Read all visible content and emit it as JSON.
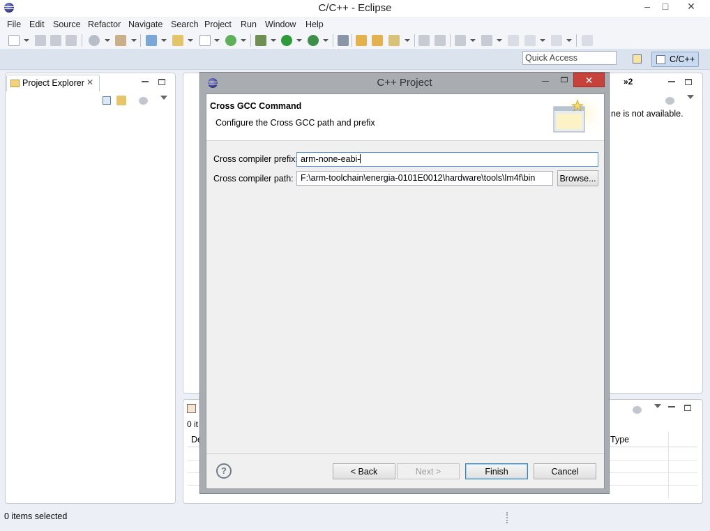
{
  "window": {
    "title": "C/C++ - Eclipse",
    "minimize": "–",
    "maximize": "□",
    "close": "✕"
  },
  "menu": [
    "File",
    "Edit",
    "Source",
    "Refactor",
    "Navigate",
    "Search",
    "Project",
    "Run",
    "Window",
    "Help"
  ],
  "quick_access": {
    "placeholder": "Quick Access"
  },
  "perspective": {
    "label": "C/C++"
  },
  "project_explorer": {
    "tab_label": "Project Explorer",
    "close": "✕"
  },
  "editor": {
    "overflow_tabs": "»2",
    "message_fragment": "ne is not available."
  },
  "bottom_panel": {
    "items_count_fragment": "0 it",
    "col_desc_fragment": "De",
    "col_type": "Type"
  },
  "status": {
    "text": "0 items selected"
  },
  "dialog": {
    "title": "C++ Project",
    "close": "✕",
    "heading": "Cross GCC Command",
    "description": "Configure the Cross GCC path and prefix",
    "fields": {
      "prefix_label": "Cross compiler prefix:",
      "prefix_value": "arm-none-eabi-",
      "path_label": "Cross compiler path:",
      "path_value": "F:\\arm-toolchain\\energia-0101E0012\\hardware\\tools\\lm4f\\bin"
    },
    "buttons": {
      "browse": "Browse...",
      "back": "< Back",
      "next": "Next >",
      "finish": "Finish",
      "cancel": "Cancel"
    },
    "help": "?"
  },
  "colors": {
    "accent": "#c7423a",
    "focus": "#5a9ad8",
    "panel_border": "#c5ccd6"
  }
}
